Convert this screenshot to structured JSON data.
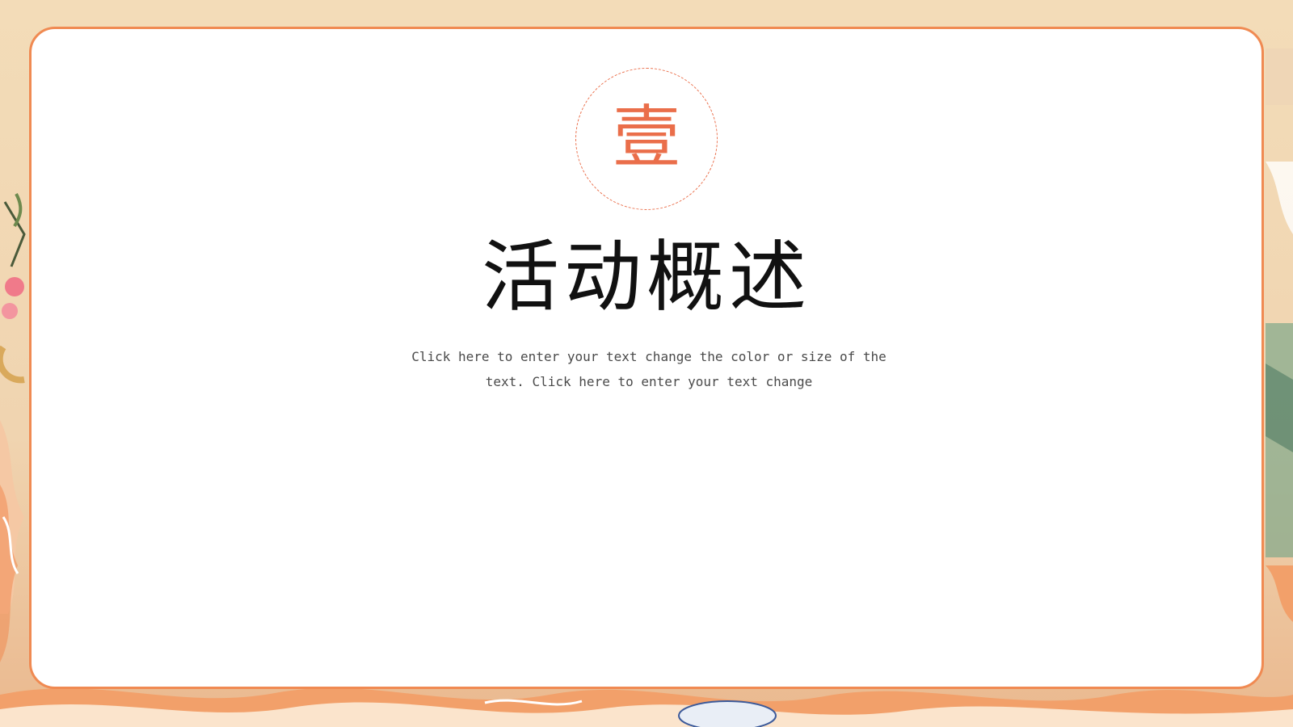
{
  "slide": {
    "seal_char": "壹",
    "title": "活动概述",
    "body_text": "Click here to enter your text change the color or size of the text. Click here to enter your text change"
  },
  "colors": {
    "accent": "#f08a52",
    "seal": "#ea6e4a",
    "title": "#111111",
    "body": "#4a4a4a",
    "card": "#ffffff"
  },
  "icons": {
    "seal": "dashed-circle-seal",
    "decoration": "chinese-painting-border"
  }
}
